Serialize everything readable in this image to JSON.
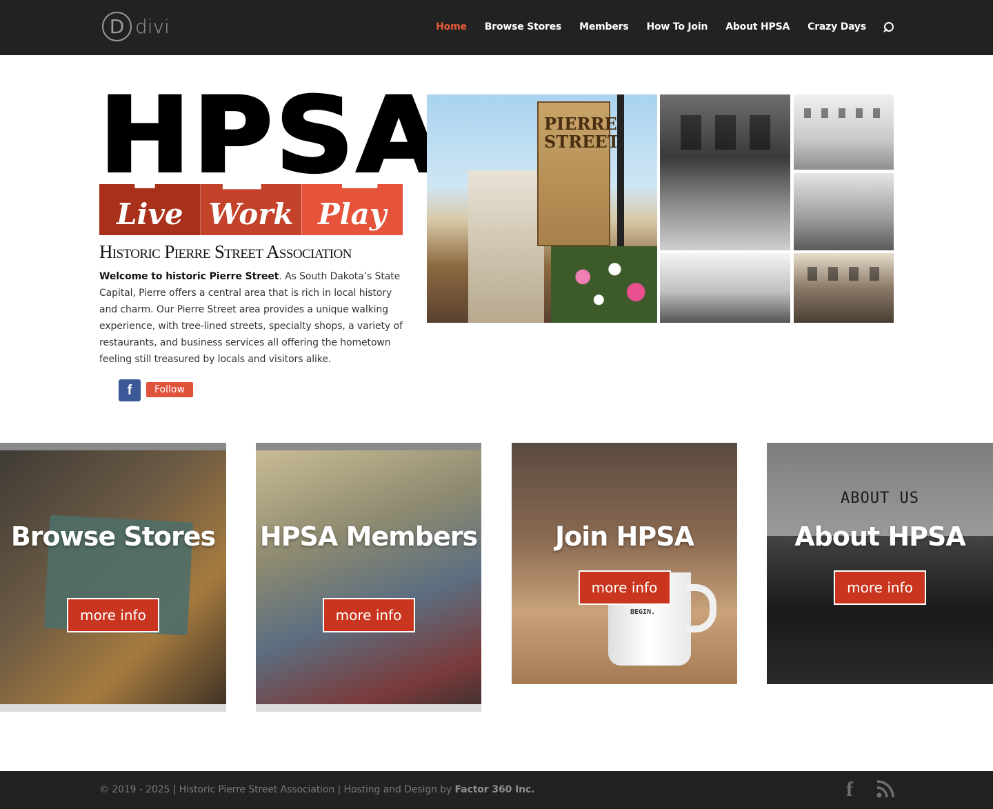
{
  "header": {
    "logo_letter": "D",
    "logo_word": "divi",
    "nav": [
      {
        "label": "Home",
        "active": true
      },
      {
        "label": "Browse Stores"
      },
      {
        "label": "Members"
      },
      {
        "label": "How To Join"
      },
      {
        "label": "About HPSA"
      },
      {
        "label": "Crazy Days"
      }
    ],
    "search_icon": "search-icon"
  },
  "hero": {
    "logo_letters": "HPSA",
    "tagline": [
      "Live",
      "Work",
      "Play"
    ],
    "association_name": "Historic Pierre Street Association",
    "intro_bold": "Welcome to historic Pierre Street",
    "intro_rest": ". As South Dakota’s State Capital, Pierre offers a central area that is rich in local history and charm. Our Pierre Street area provides a unique walking experience, with tree-lined streets, specialty shops, a variety of restaurants, and business services all offering the hometown feeling still treasured by locals and visitors alike.",
    "facebook_glyph": "f",
    "follow_label": "Follow",
    "banner_text": "PIERRE STREET"
  },
  "cards": [
    {
      "title": "Browse Stores",
      "button": "more info"
    },
    {
      "title": "HPSA Members",
      "button": "more info"
    },
    {
      "title": "Join HPSA",
      "button": "more info",
      "mug_text": "BEGIN."
    },
    {
      "title": "About HPSA",
      "button": "more info",
      "image_text": "ABOUT US"
    }
  ],
  "footer": {
    "text": "© 2019 - 2025 | Historic Pierre Street Association | Hosting and Design by ",
    "credit": "Factor 360 Inc.",
    "facebook_glyph": "f"
  },
  "colors": {
    "header_bg": "#222222",
    "accent": "#e85a3a",
    "button_red": "#c9351f",
    "facebook_blue": "#3b5998"
  }
}
